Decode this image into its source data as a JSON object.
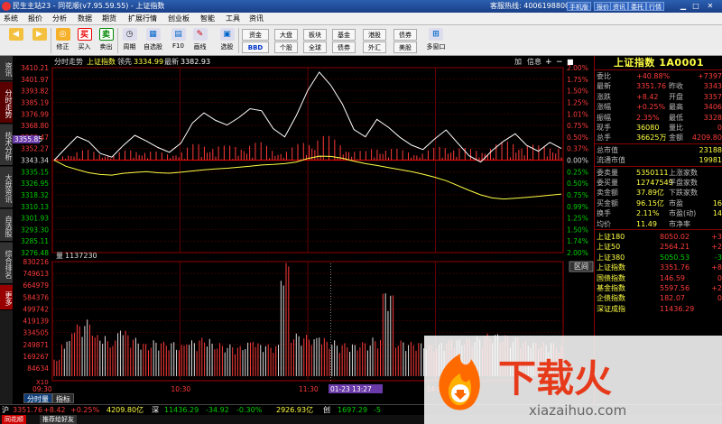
{
  "app": {
    "title": "民生主站23 - 同花顺(v7.95.59.55) - 上证指数",
    "hotline": "客服热线: 4006198800",
    "title_buttons": [
      "手机版",
      "报价",
      "资讯",
      "委托",
      "行情"
    ]
  },
  "menu": [
    "系统",
    "报价",
    "分析",
    "数据",
    "期货",
    "扩展行情",
    "创业板",
    "智能",
    "工具",
    "资讯"
  ],
  "toolbar": {
    "buttons": [
      {
        "label": "",
        "icon": "back-arrow-icon"
      },
      {
        "label": "",
        "icon": "forward-arrow-icon"
      },
      {
        "label": "修正",
        "icon": "correct-icon"
      },
      {
        "label": "买入",
        "icon": "buy-icon",
        "glyph": "买"
      },
      {
        "label": "卖出",
        "icon": "sell-icon",
        "glyph": "卖"
      },
      {
        "label": "周期",
        "icon": "period-icon"
      },
      {
        "label": "自选股",
        "icon": "watchlist-icon"
      },
      {
        "label": "F10",
        "icon": "f10-icon"
      },
      {
        "label": "画线",
        "icon": "draw-line-icon"
      },
      {
        "label": "选股",
        "icon": "stock-picker-icon"
      }
    ],
    "quick_buttons": [
      "资金",
      "BBD",
      "大盘",
      "个股",
      "板块",
      "全球",
      "基金",
      "债券",
      "港股",
      "外汇",
      "债券",
      "美股",
      "多窗口"
    ]
  },
  "left_tabs": [
    "资讯",
    "分时走势",
    "技术分析",
    "大盘资讯",
    "自选股",
    "综合排名",
    "更多"
  ],
  "chart": {
    "header_label": "分时走势",
    "index_name": "上证指数",
    "lead_label": "领先",
    "lead_value": "3334.99",
    "latest_label": "最新",
    "latest_value": "3382.93",
    "toolbar_items": [
      "加",
      "信息",
      "+",
      "−",
      "■"
    ],
    "price_ticks": [
      "3410.21",
      "3401.97",
      "3393.82",
      "3385.19",
      "3376.99",
      "3368.80",
      "3360.47",
      "3352.27",
      "3343.34",
      "3335.15",
      "3326.95",
      "3318.32",
      "3310.13",
      "3301.93",
      "3293.30",
      "3285.11",
      "3276.48"
    ],
    "pct_ticks": [
      "2.00%",
      "1.75%",
      "1.50%",
      "1.25%",
      "1.01%",
      "0.75%",
      "0.50%",
      "0.37%",
      "0.00%",
      "0.25%",
      "0.50%",
      "0.75%",
      "0.99%",
      "1.25%",
      "1.50%",
      "1.74%",
      "2.00%"
    ],
    "highlight_price": "3355.85",
    "volume_label": "量",
    "volume_value": "1137230",
    "volume_ticks": [
      "830216",
      "749613",
      "664979",
      "584376",
      "499742",
      "419139",
      "334505",
      "249871",
      "169267",
      "84634"
    ],
    "volume_unit": "X10",
    "range_btn": "区间",
    "time_ticks": [
      "09:30",
      "10:30",
      "11:30",
      "01-23 13:27",
      "14:00"
    ],
    "cursor_time": "01-23 13:27"
  },
  "chart_data": {
    "type": "line",
    "title": "上证指数",
    "series": [
      {
        "name": "上证指数",
        "values": [
          3343.3,
          3352.1,
          3360.4,
          3356.8,
          3348.2,
          3345.5,
          3354.0,
          3361.3,
          3357.2,
          3352.5,
          3349.0,
          3355.6,
          3370.2,
          3377.5,
          3372.1,
          3368.7,
          3374.0,
          3380.5,
          3379.0,
          3366.2,
          3360.1,
          3375.4,
          3393.8,
          3407.0,
          3397.5,
          3384.0,
          3365.5,
          3360.2,
          3372.8,
          3367.1,
          3359.8,
          3354.2,
          3351.0,
          3358.6,
          3365.2,
          3355.8,
          3346.5,
          3342.0,
          3350.3,
          3357.1,
          3362.4,
          3354.0,
          3349.8,
          3356.2,
          3351.76
        ]
      },
      {
        "name": "均价",
        "values": [
          3343.3,
          3339.0,
          3336.5,
          3334.2,
          3333.0,
          3332.5,
          3333.8,
          3334.5,
          3335.0,
          3334.2,
          3333.9,
          3334.6,
          3335.5,
          3336.3,
          3337.0,
          3337.5,
          3338.2,
          3339.0,
          3339.8,
          3340.2,
          3340.8,
          3342.0,
          3344.5,
          3346.2,
          3346.0,
          3344.7,
          3342.6,
          3340.8,
          3339.5,
          3338.0,
          3336.5,
          3335.0,
          3333.2,
          3331.0,
          3328.5,
          3325.0,
          3321.5,
          3318.2,
          3316.0,
          3315.2,
          3315.8,
          3316.5,
          3317.2,
          3318.0,
          3318.8
        ]
      }
    ],
    "ylim": [
      3276.48,
      3410.21
    ],
    "prev_close": 3343.34,
    "volume": [
      120000,
      260000,
      380000,
      410000,
      300000,
      260000,
      330000,
      280000,
      240000,
      260000,
      250000,
      230000,
      260000,
      280000,
      240000,
      230000,
      220000,
      250000,
      240000,
      230000,
      820000,
      310000,
      300000,
      280000,
      260000,
      240000,
      230000,
      250000,
      280000,
      600000,
      260000,
      250000,
      240000,
      230000,
      260000,
      270000,
      280000,
      290000,
      310000,
      300000,
      280000,
      260000,
      250000,
      240000,
      230000
    ],
    "volume_ylim": [
      0,
      830216
    ]
  },
  "quote_panel": {
    "title": "上证指数 1A0001",
    "rows": [
      {
        "l1": "委比",
        "v1": "+40.88%",
        "l2": "",
        "v2": "+7397"
      },
      {
        "l1": "最新",
        "v1": "3351.76",
        "l2": "昨收",
        "v2": "3343"
      },
      {
        "l1": "涨跌",
        "v1": "+8.42",
        "l2": "开盘",
        "v2": "3357"
      },
      {
        "l1": "涨幅",
        "v1": "+0.25%",
        "l2": "最高",
        "v2": "3406"
      },
      {
        "l1": "振幅",
        "v1": "2.35%",
        "l2": "最低",
        "v2": "3328"
      },
      {
        "l1": "现手",
        "v1": "36080",
        "l2": "量比",
        "v2": "0"
      },
      {
        "l1": "总手",
        "v1": "36625万",
        "l2": "金额",
        "v2": "4209.80"
      },
      {
        "l1": "总市值",
        "v1": "",
        "l2": "",
        "v2": "23188"
      },
      {
        "l1": "流通市值",
        "v1": "",
        "l2": "",
        "v2": "19981"
      },
      {
        "l1": "委卖量",
        "v1": "5350111",
        "l2": "上涨家数",
        "v2": ""
      },
      {
        "l1": "委买量",
        "v1": "12747549",
        "l2": "平盘家数",
        "v2": ""
      },
      {
        "l1": "卖金额",
        "v1": "37.89亿",
        "l2": "下跌家数",
        "v2": ""
      },
      {
        "l1": "买金额",
        "v1": "96.15亿",
        "l2": "市盈",
        "v2": "16"
      },
      {
        "l1": "换手",
        "v1": "2.11%",
        "l2": "市盈(动)",
        "v2": "14"
      },
      {
        "l1": "均价",
        "v1": "11.49",
        "l2": "市净率",
        "v2": ""
      }
    ],
    "index_list": [
      {
        "name": "上证180",
        "value": "8050.02",
        "chg": "+3"
      },
      {
        "name": "上证50",
        "value": "2564.21",
        "chg": "+2"
      },
      {
        "name": "上证380",
        "value": "5050.53",
        "chg": "-3"
      },
      {
        "name": "上证指数",
        "value": "3351.76",
        "chg": "+8"
      },
      {
        "name": "国债指数",
        "value": "146.59",
        "chg": "0"
      },
      {
        "name": "基金指数",
        "value": "5597.56",
        "chg": "+2"
      },
      {
        "name": "企债指数",
        "value": "182.07",
        "chg": "0"
      },
      {
        "name": "深证成指",
        "value": "11436.29",
        "chg": ""
      }
    ]
  },
  "bottom_tabs": [
    "分时量",
    "指标"
  ],
  "status": {
    "sh_label": "沪",
    "sh_value": "3351.76",
    "sh_chg": "+8.42",
    "sh_pct": "+0.25%",
    "sh_amt": "4209.80亿",
    "sz_label": "深",
    "sz_value": "11436.29",
    "sz_chg": "-34.92",
    "sz_pct": "-0.30%",
    "sz_amt": "2926.93亿",
    "cy_label": "创",
    "cy_value": "1697.29",
    "cy_chg": "-5"
  },
  "footer_tabs": [
    "同花顺",
    "推荐给好友"
  ],
  "watermark": {
    "brand": "下载火",
    "url": "xiazaihuo.com"
  },
  "colors": {
    "up": "#ff3b3b",
    "down": "#00d000",
    "price_line": "#ffffff",
    "avg_line": "#ffff44",
    "grid": "#800000"
  }
}
